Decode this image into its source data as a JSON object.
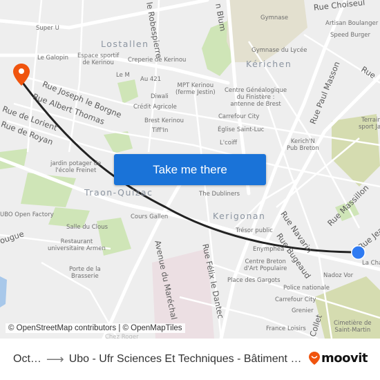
{
  "map": {
    "districts": [
      {
        "name": "Lostallen"
      },
      {
        "name": "Kérichen"
      },
      {
        "name": "Traon-Quizac"
      },
      {
        "name": "Kerigonan"
      }
    ],
    "streets": [
      {
        "name": "Rue Choiseul"
      },
      {
        "name": "Rue Paul Masson"
      },
      {
        "name": "Rue Joseph le Borgne"
      },
      {
        "name": "Rue Albert Thomas"
      },
      {
        "name": "Rue de Lorient"
      },
      {
        "name": "Rue de Royan"
      },
      {
        "name": "Rue Massillon"
      },
      {
        "name": "Rue Navarin"
      },
      {
        "name": "Rue Bugeaud"
      },
      {
        "name": "Avenue du Maréchal"
      },
      {
        "name": "Rue Félix le Dantec"
      },
      {
        "name": "le Robespierre"
      },
      {
        "name": "n Blum"
      },
      {
        "name": "Rue Jea"
      },
      {
        "name": "Rue"
      },
      {
        "name": "ougue"
      },
      {
        "name": "Collet"
      }
    ],
    "pois": [
      {
        "name": "Super U"
      },
      {
        "name": "Le Galopin"
      },
      {
        "name": "Espace sportif\nde Kerinou"
      },
      {
        "name": "Creperie de Kerinou"
      },
      {
        "name": "Le M"
      },
      {
        "name": "Au 421"
      },
      {
        "name": "MPT Kerinou\n(ferme Jestin)"
      },
      {
        "name": "Diwali"
      },
      {
        "name": "Crédit Agricole"
      },
      {
        "name": "Brest Kerinou"
      },
      {
        "name": "Tiff'In"
      },
      {
        "name": "Gymnase"
      },
      {
        "name": "Gymnase du Lycée"
      },
      {
        "name": "Artisan Boulanger"
      },
      {
        "name": "Speed Burger"
      },
      {
        "name": "Centre Généalogique\ndu Finistère :\nantenne de Brest"
      },
      {
        "name": "Carrefour City"
      },
      {
        "name": "Église Saint-Luc"
      },
      {
        "name": "L'coiff"
      },
      {
        "name": "Kerich'N\nPub Breton"
      },
      {
        "name": "Terrain\nsport Jac"
      },
      {
        "name": "jardin potager de\nl'école Freinet"
      },
      {
        "name": "UBO Open Factory"
      },
      {
        "name": "Salle du Clous"
      },
      {
        "name": "Restaurant\nuniversitaire Armen"
      },
      {
        "name": "Porte de la\nBrasserie"
      },
      {
        "name": "Cours Gallen"
      },
      {
        "name": "The Dubliners"
      },
      {
        "name": "Trésor public"
      },
      {
        "name": "Enymphéa"
      },
      {
        "name": "Centre Breton\nd'Art Populaire"
      },
      {
        "name": "Place des Gargots"
      },
      {
        "name": "Police nationale"
      },
      {
        "name": "Carrefour City"
      },
      {
        "name": "Grenier"
      },
      {
        "name": "France Loisirs"
      },
      {
        "name": "Nadoz Vor"
      },
      {
        "name": "La Cha"
      },
      {
        "name": "Cimetière de\nSaint-Martin"
      },
      {
        "name": "Chez Roger"
      }
    ],
    "attribution": "© OpenStreetMap contributors | © OpenMapTiles",
    "cta_label": "Take me there",
    "colors": {
      "origin_pin": "#f0540e",
      "destination_dot": "#2f7bf2",
      "route": "#222222",
      "cta": "#1a73d8"
    }
  },
  "footer": {
    "origin": "Oct…",
    "arrow": "⟶",
    "destination": "Ubo - Ufr Sciences Et Techniques - Bâtiment …",
    "brand": "moovit"
  }
}
